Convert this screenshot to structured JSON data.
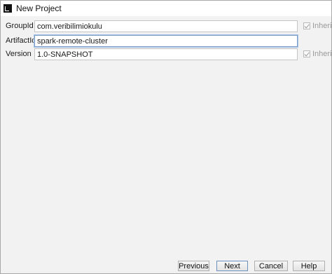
{
  "window": {
    "title": "New Project"
  },
  "form": {
    "group_id": {
      "label": "GroupId",
      "value": "com.veribilimiokulu",
      "inherit_label": "Inherit",
      "inherit_checked": true
    },
    "artifact_id": {
      "label": "ArtifactId",
      "value": "spark-remote-cluster"
    },
    "version": {
      "label": "Version",
      "value": "1.0-SNAPSHOT",
      "inherit_label": "Inherit",
      "inherit_checked": true
    }
  },
  "footer": {
    "previous_label": "Previous",
    "next_label": "Next",
    "cancel_label": "Cancel",
    "help_label": "Help"
  }
}
